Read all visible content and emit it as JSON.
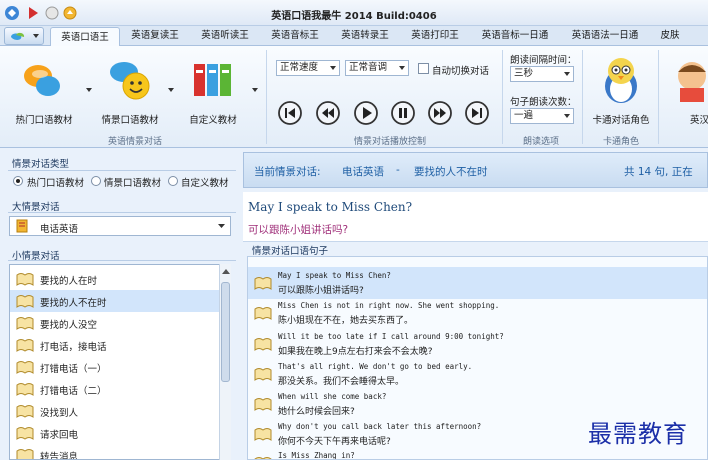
{
  "window": {
    "title": "英语口语我最牛 2014 Build:0406"
  },
  "tabs": [
    {
      "label": "英语口语王"
    },
    {
      "label": "英语复读王"
    },
    {
      "label": "英语听读王"
    },
    {
      "label": "英语音标王"
    },
    {
      "label": "英语转录王"
    },
    {
      "label": "英语打印王"
    },
    {
      "label": "英语音标一日通"
    },
    {
      "label": "英语语法一日通"
    },
    {
      "label": "皮肤"
    }
  ],
  "ribbon": {
    "btn_hot": "热门口语教材",
    "btn_scene": "情景口语教材",
    "btn_custom": "自定义教材",
    "group_scene": "英语情景对话",
    "speed_value": "正常速度",
    "tone_value": "正常音调",
    "auto_switch": "自动切换对话",
    "group_play": "情景对话播放控制",
    "interval_label": "朗读间隔时间：",
    "interval_value": "三秒",
    "repeat_label": "句子朗读次数：",
    "repeat_value": "一遍",
    "group_read": "朗读选项",
    "btn_cartoon": "卡通对话角色",
    "group_cartoon": "卡通角色",
    "btn_partial": "英汉"
  },
  "left": {
    "type_title": "情景对话类型",
    "type_options": [
      "热门口语教材",
      "情景口语教材",
      "自定义教材"
    ],
    "big_title": "大情景对话",
    "big_value": "电话英语",
    "small_title": "小情景对话",
    "small_items": [
      "要找的人在时",
      "要找的人不在时",
      "要找的人没空",
      "打电话，接电话",
      "打错电话（一）",
      "打错电话（二）",
      "没找到人",
      "请求回电",
      "转告消息"
    ]
  },
  "current": {
    "prefix": "当前情景对话:",
    "category": "电话英语",
    "dash": "-",
    "scene": "要找的人不在时",
    "count": "共 14 句, 正在"
  },
  "sentence": {
    "en": "May I speak to Miss Chen?",
    "cn": "可以跟陈小姐讲话吗?"
  },
  "dialog_title": "情景对话口语句子",
  "dialog": [
    {
      "en": "May I speak to Miss Chen?",
      "cn": "可以跟陈小姐讲话吗?"
    },
    {
      "en": "Miss Chen is not in right now. She went shopping.",
      "cn": "陈小姐现在不在，她去买东西了。"
    },
    {
      "en": "Will it be too late if I call around 9:00 tonight?",
      "cn": "如果我在晚上9点左右打来会不会太晚?"
    },
    {
      "en": "That's all right. We don't go to bed early.",
      "cn": "那没关系。我们不会睡得太早。"
    },
    {
      "en": "When will she come back?",
      "cn": "她什么时候会回来?"
    },
    {
      "en": "Why don't you call back later this afternoon?",
      "cn": "你何不今天下午再来电话呢?"
    },
    {
      "en": "Is Miss Zhang in?",
      "cn": ""
    }
  ],
  "watermark": "最需教育",
  "colors": {
    "accent": "#1e5fa4",
    "selection": "#d2e5fb",
    "chinese_sentence": "#a0307a"
  }
}
